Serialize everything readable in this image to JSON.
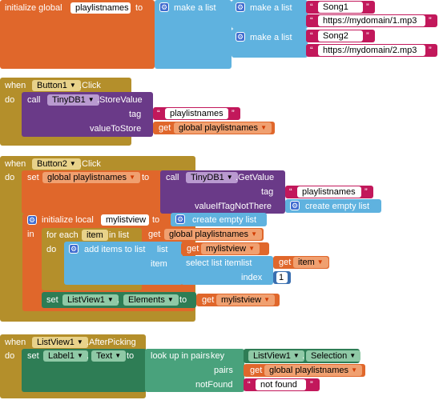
{
  "block1": {
    "initialize_global": "initialize global",
    "var_name": "playlistnames",
    "to": "to",
    "make_a_list_outer": "make a list",
    "make_a_list_1": "make a list",
    "make_a_list_2": "make a list",
    "song1": "Song1",
    "url1": "https://mydomain/1.mp3",
    "song2": "Song2",
    "url2": "https://mydomain/2.mp3"
  },
  "block2": {
    "when": "when",
    "component": "Button1",
    "event": ".Click",
    "do": "do",
    "call": "call",
    "db": "TinyDB1",
    "method": ".StoreValue",
    "tag": "tag",
    "tag_value": "playlistnames",
    "value_to_store": "valueToStore",
    "get": "get",
    "get_var": "global playlistnames"
  },
  "block3": {
    "when": "when",
    "component": "Button2",
    "event": ".Click",
    "do": "do",
    "set": "set",
    "set_var": "global playlistnames",
    "to": "to",
    "call": "call",
    "db": "TinyDB1",
    "method": ".GetValue",
    "tag": "tag",
    "tag_value": "playlistnames",
    "value_if_not": "valueIfTagNotThere",
    "create_empty_list_1": "create empty list",
    "initialize_local": "initialize local",
    "local_name": "mylistview",
    "to2": "to",
    "create_empty_list_2": "create empty list",
    "in": "in",
    "for_each": "for each",
    "item": "item",
    "in_list": "in list",
    "get1": "get",
    "get1_var": "global playlistnames",
    "do2": "do",
    "add_items": "add items to list",
    "list": "list",
    "get2": "get",
    "get2_var": "mylistview",
    "item_label": "item",
    "select_item": "select list item",
    "list2": "list",
    "get3": "get",
    "get3_var": "item",
    "index": "index",
    "index_value": "1",
    "set2": "set",
    "listview": "ListView1",
    "dot": ".",
    "elements": "Elements",
    "to3": "to",
    "get4": "get",
    "get4_var": "mylistview"
  },
  "block4": {
    "when": "when",
    "component": "ListView1",
    "event": ".AfterPicking",
    "do": "do",
    "set": "set",
    "label": "Label1",
    "dot": ".",
    "text_prop": "Text",
    "to": "to",
    "lookup": "look up in pairs",
    "key": "key",
    "key_comp": "ListView1",
    "key_dot": ".",
    "selection": "Selection",
    "pairs": "pairs",
    "get": "get",
    "get_var": "global playlistnames",
    "not_found": "notFound",
    "not_found_value": "not found"
  },
  "colors": {
    "variables": "#e0672b",
    "lists": "#5fb2df",
    "text": "#c2185b",
    "events": "#b48f2b",
    "tinydb": "#6a3a88",
    "components": "#2e7d55"
  },
  "icons": [
    "gear-icon",
    "dropdown-arrow-icon"
  ]
}
